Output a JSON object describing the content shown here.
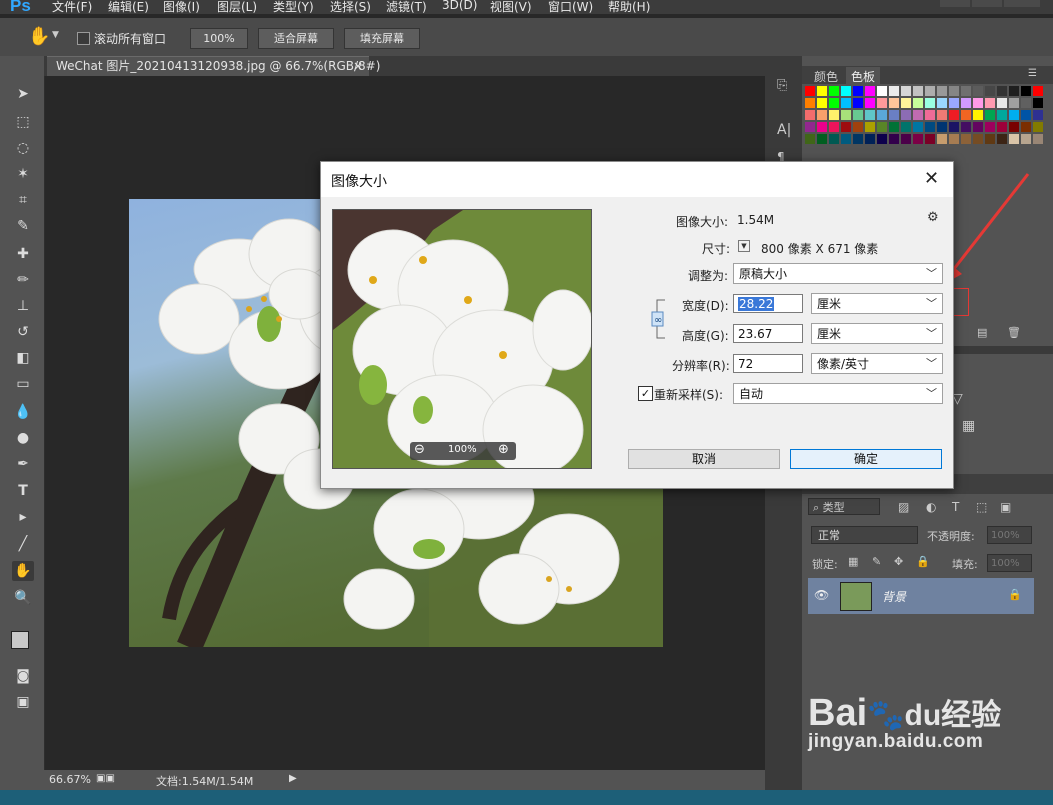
{
  "app": {
    "logo": "Ps"
  },
  "menu": [
    "文件(F)",
    "编辑(E)",
    "图像(I)",
    "图层(L)",
    "类型(Y)",
    "选择(S)",
    "滤镜(T)",
    "3D(D)",
    "视图(V)",
    "窗口(W)",
    "帮助(H)"
  ],
  "options": {
    "scroll_all_label": "滚动所有窗口",
    "zoom_100": "100%",
    "fit_screen": "适合屏幕",
    "fill_screen": "填充屏幕"
  },
  "document_tab": {
    "title": "WeChat 图片_20210413120938.jpg @ 66.7%(RGB/8#)",
    "close": "×"
  },
  "status": {
    "zoom": "66.67%",
    "doc": "文档:1.54M/1.54M"
  },
  "panels": {
    "color_tab": "颜色",
    "swatches_tab": "色板",
    "layers": {
      "kind_label": "类型",
      "blend_mode": "正常",
      "opacity_label": "不透明度:",
      "opacity_value": "100%",
      "lock_label": "锁定:",
      "fill_label": "填充:",
      "fill_value": "100%",
      "layer_name": "背景"
    }
  },
  "swatch_colors": [
    [
      "#ff0000",
      "#ffff00",
      "#00ff00",
      "#00ffff",
      "#0000ff",
      "#ff00ff",
      "#ffffff",
      "#ebebeb",
      "#d6d6d6",
      "#c2c2c2",
      "#adadad",
      "#999999",
      "#858585",
      "#707070",
      "#5c5c5c",
      "#474747",
      "#333333",
      "#1f1f1f",
      "#000000",
      "#ff0000"
    ],
    [
      "#ff7f00",
      "#ffff00",
      "#00ff00",
      "#00bfff",
      "#0000ff",
      "#ff00ff",
      "#ff9a9a",
      "#ffc59a",
      "#fff49a",
      "#c6ff9a",
      "#9affe1",
      "#9ad8ff",
      "#9aa8ff",
      "#d09aff",
      "#ff9ae8",
      "#ff9ab0",
      "#e8e8e8",
      "#a0a0a0",
      "#606060",
      "#000000"
    ],
    [
      "#f26c6c",
      "#f7a06b",
      "#fff26b",
      "#a8e07a",
      "#68c991",
      "#5fc6c8",
      "#5aa7d9",
      "#6a7fc4",
      "#8c6cb4",
      "#c16bb0",
      "#ef6b97",
      "#f07a74",
      "#ed1c24",
      "#f26522",
      "#fff200",
      "#00a651",
      "#00a99d",
      "#00aeef",
      "#0054a6",
      "#2e3192"
    ],
    [
      "#92278f",
      "#ec008c",
      "#ed145b",
      "#9e0b0f",
      "#a0410d",
      "#aba000",
      "#598527",
      "#007236",
      "#00746b",
      "#0076a3",
      "#004a80",
      "#003471",
      "#1b1464",
      "#440e62",
      "#630460",
      "#9e005d",
      "#9e0039",
      "#790000",
      "#7b2e00",
      "#827b00"
    ],
    [
      "#406618",
      "#005e20",
      "#005952",
      "#005b7f",
      "#003663",
      "#002157",
      "#0d004c",
      "#32004b",
      "#4b0049",
      "#7b0046",
      "#7a0026",
      "#c69c6d",
      "#a67c52",
      "#8c6239",
      "#754c24",
      "#603913",
      "#3c2415",
      "#d9c4a8",
      "#b7a58f",
      "#998675"
    ]
  ],
  "dialog": {
    "title": "图像大小",
    "close": "✕",
    "preview_zoom": "100%",
    "image_size_label": "图像大小:",
    "image_size_value": "1.54M",
    "dimensions_label": "尺寸:",
    "dimensions_value": "800 像素  X  671 像素",
    "fit_to_label": "调整为:",
    "fit_to_value": "原稿大小",
    "width_label": "宽度(D):",
    "width_value": "28.22",
    "width_unit": "厘米",
    "height_label": "高度(G):",
    "height_value": "23.67",
    "height_unit": "厘米",
    "resolution_label": "分辨率(R):",
    "resolution_value": "72",
    "resolution_unit": "像素/英寸",
    "resample_label": "重新采样(S):",
    "resample_value": "自动",
    "cancel": "取消",
    "ok": "确定"
  },
  "watermark": {
    "brand": "Bai",
    "brand2": "du",
    "cn": "经验",
    "url": "jingyan.baidu.com"
  }
}
